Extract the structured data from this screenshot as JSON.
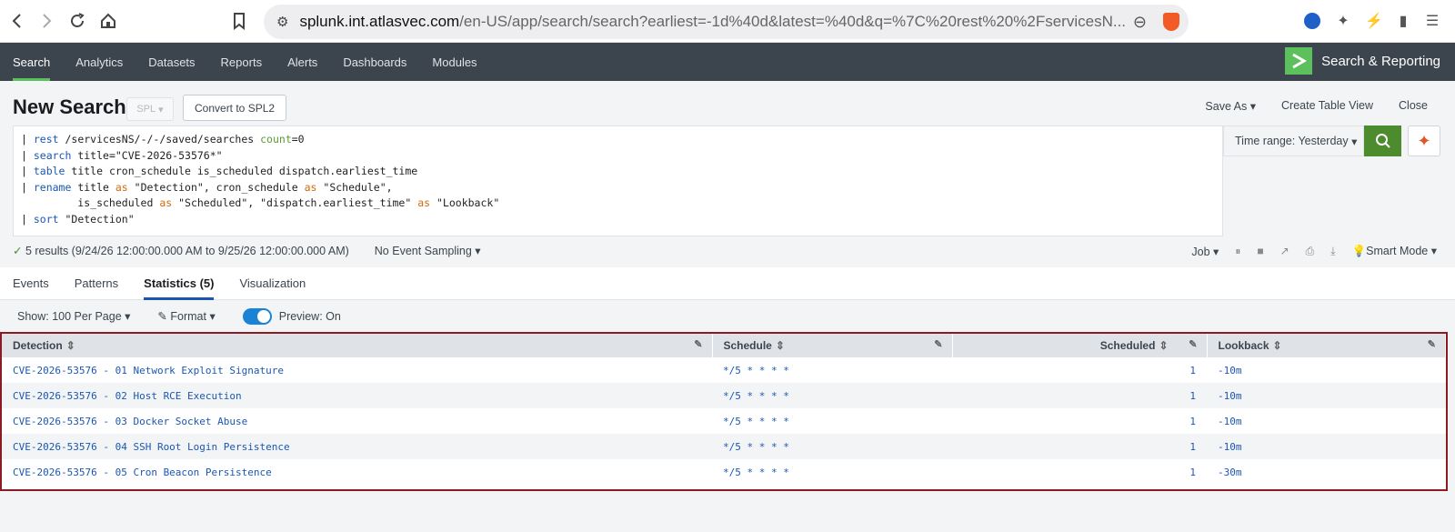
{
  "browser": {
    "url_host": "splunk.int.atlasvec.com",
    "url_path": "/en-US/app/search/search?earliest=-1d%40d&latest=%40d&q=%7C%20rest%20%2FservicesN..."
  },
  "appbar": {
    "tabs": [
      "Search",
      "Analytics",
      "Datasets",
      "Reports",
      "Alerts",
      "Dashboards",
      "Modules"
    ],
    "app_name": "Search & Reporting"
  },
  "header": {
    "title": "New Search",
    "spl_label": "SPL",
    "convert_label": "Convert to SPL2",
    "save_as": "Save As",
    "create_table_view": "Create Table View",
    "close": "Close"
  },
  "query": {
    "lines": [
      "| rest /servicesNS/-/-/saved/searches count=0",
      "| search title=\"CVE-2026-53576*\"",
      "| table title cron_schedule is_scheduled dispatch.earliest_time",
      "| rename title as \"Detection\", cron_schedule as \"Schedule\",",
      "         is_scheduled as \"Scheduled\", \"dispatch.earliest_time\" as \"Lookback\"",
      "| sort \"Detection\""
    ]
  },
  "time_range": "Time range: Yesterday",
  "status": {
    "results": "5 results (9/24/26 12:00:00.000 AM to 9/25/26 12:00:00.000 AM)",
    "sampling": "No Event Sampling",
    "job": "Job",
    "mode": "Smart Mode"
  },
  "tabs": [
    "Events",
    "Patterns",
    "Statistics (5)",
    "Visualization"
  ],
  "toolbar": {
    "show": "Show: 100 Per Page",
    "format": "Format",
    "preview": "Preview: On"
  },
  "table": {
    "columns": [
      "Detection",
      "Schedule",
      "Scheduled",
      "Lookback"
    ],
    "rows": [
      [
        "CVE-2026-53576 - 01 Network Exploit Signature",
        "*/5 * * * *",
        "1",
        "-10m"
      ],
      [
        "CVE-2026-53576 - 02 Host RCE Execution",
        "*/5 * * * *",
        "1",
        "-10m"
      ],
      [
        "CVE-2026-53576 - 03 Docker Socket Abuse",
        "*/5 * * * *",
        "1",
        "-10m"
      ],
      [
        "CVE-2026-53576 - 04 SSH Root Login Persistence",
        "*/5 * * * *",
        "1",
        "-10m"
      ],
      [
        "CVE-2026-53576 - 05 Cron Beacon Persistence",
        "*/5 * * * *",
        "1",
        "-30m"
      ]
    ]
  }
}
